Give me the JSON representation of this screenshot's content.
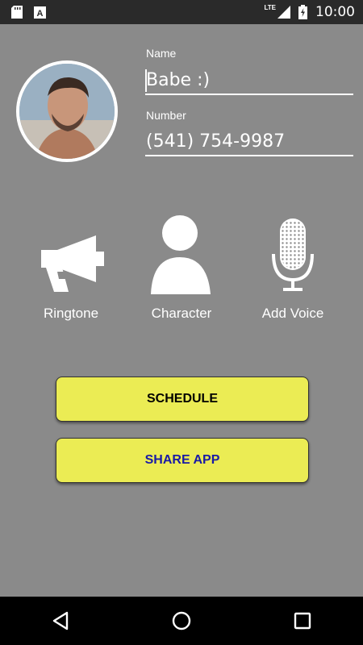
{
  "status_bar": {
    "time": "10:00",
    "network": "LTE",
    "icons": [
      "sd-card-icon",
      "font-icon",
      "signal-icon",
      "battery-charging-icon"
    ]
  },
  "contact": {
    "avatar": "avatar-photo",
    "name_label": "Name",
    "name_value": "Babe :)",
    "number_label": "Number",
    "number_value": "(541) 754-9987"
  },
  "options": [
    {
      "label": "Ringtone",
      "icon": "megaphone-icon"
    },
    {
      "label": "Character",
      "icon": "person-icon"
    },
    {
      "label": "Add Voice",
      "icon": "microphone-icon"
    }
  ],
  "buttons": {
    "schedule": "SCHEDULE",
    "share": "SHARE APP"
  },
  "colors": {
    "background": "#8a8a8a",
    "button": "#ebec54",
    "schedule_text": "#000000",
    "share_text": "#1a1aa6"
  },
  "nav": [
    "back-icon",
    "home-icon",
    "recents-icon"
  ]
}
